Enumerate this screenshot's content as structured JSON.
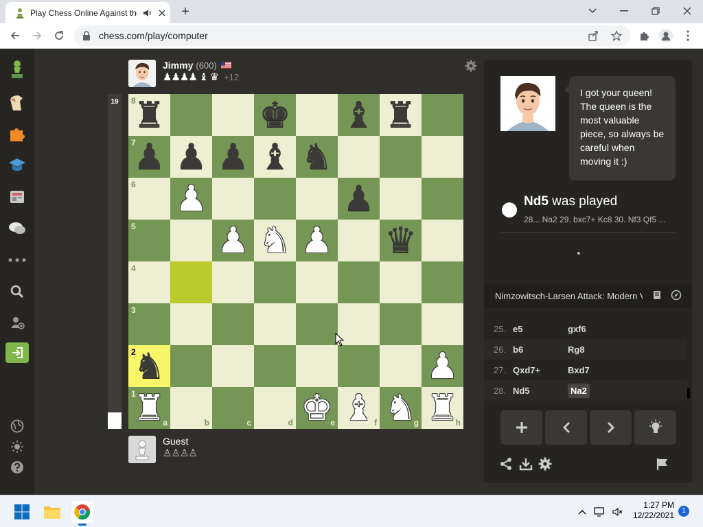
{
  "browser": {
    "tab_title": "Play Chess Online Against the Computer",
    "url": "chess.com/play/computer",
    "new_tab_symbol": "+"
  },
  "sidebar": {
    "items": [
      "logo-pawn-icon",
      "play-icon",
      "puzzles-icon",
      "learn-icon",
      "watch-icon",
      "social-icon",
      "more-icon",
      "search-icon",
      "add-friend-icon",
      "login-icon",
      "language-icon",
      "theme-icon",
      "help-icon"
    ]
  },
  "opponent": {
    "name": "Jimmy",
    "rating": "(600)",
    "flag": "US",
    "captured": "♟♟♟♟ ♝ ♛",
    "advantage": "+12"
  },
  "player": {
    "name": "Guest",
    "captured": "♙♙♙♙"
  },
  "eval": {
    "value": "19",
    "white_fraction": 0.05
  },
  "board": {
    "ranks": [
      "8",
      "7",
      "6",
      "5",
      "4",
      "3",
      "2",
      "1"
    ],
    "files": [
      "a",
      "b",
      "c",
      "d",
      "e",
      "f",
      "g",
      "h"
    ],
    "highlight": [
      "b4",
      "a2"
    ],
    "position": [
      [
        "br",
        "",
        "",
        "bk",
        "",
        "bb",
        "br",
        ""
      ],
      [
        "bp",
        "bp",
        "bp",
        "bb",
        "bn",
        "",
        "",
        ""
      ],
      [
        "",
        "wp",
        "",
        "",
        "",
        "bp",
        "",
        ""
      ],
      [
        "",
        "",
        "wp",
        "wn",
        "wp",
        "",
        "bq",
        ""
      ],
      [
        "",
        "",
        "",
        "",
        "",
        "",
        "",
        ""
      ],
      [
        "",
        "",
        "",
        "",
        "",
        "",
        "",
        ""
      ],
      [
        "bn",
        "",
        "",
        "",
        "",
        "",
        "",
        "wp"
      ],
      [
        "wr",
        "",
        "",
        "",
        "wk",
        "wb",
        "wn",
        "wr"
      ]
    ]
  },
  "coach": {
    "message": "I got your queen! The queen is the most valuable piece, so always be careful when moving it :)"
  },
  "last_move": {
    "move": "Nd5",
    "suffix": " was played",
    "line": "28... Na2 29. bxc7+ Kc8 30. Nf3 Qf5 ..."
  },
  "opening": {
    "name": "Nimzowitsch-Larsen Attack: Modern Variation"
  },
  "moves": [
    {
      "num": "25.",
      "white": "e5",
      "black": "gxf6"
    },
    {
      "num": "26.",
      "white": "b6",
      "black": "Rg8"
    },
    {
      "num": "27.",
      "white": "Qxd7+",
      "black": "Bxd7"
    },
    {
      "num": "28.",
      "white": "Nd5",
      "black": "Na2"
    }
  ],
  "controls": [
    "plus-icon",
    "prev-icon",
    "next-icon",
    "hint-lightbulb-icon"
  ],
  "colors": {
    "light_square": "#eeeed2",
    "dark_square": "#769656",
    "highlight_light": "#f7f769",
    "highlight_dark": "#bbcb2b",
    "background": "#302e2b"
  },
  "taskbar": {
    "time": "1:27 PM",
    "date": "12/22/2021",
    "notifications": "1"
  }
}
